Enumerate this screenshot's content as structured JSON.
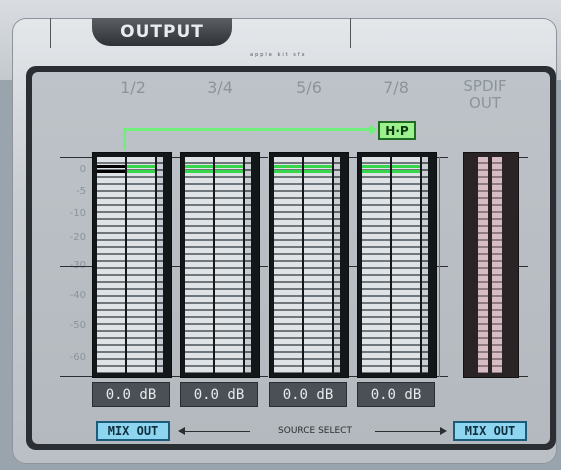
{
  "header": {
    "tab_label": "OUTPUT",
    "tiny_labels": "apple kit sfx"
  },
  "channels": [
    {
      "label": "1/2",
      "level": "0.0 dB",
      "clip": true
    },
    {
      "label": "3/4",
      "level": "0.0 dB",
      "clip": false
    },
    {
      "label": "5/6",
      "level": "0.0 dB",
      "clip": false
    },
    {
      "label": "7/8",
      "level": "0.0 dB",
      "clip": false
    }
  ],
  "spdif": {
    "label_line1": "SPDIF",
    "label_line2": "OUT"
  },
  "routing": {
    "hp_label": "H·P"
  },
  "scale": [
    "0",
    "-5",
    "-10",
    "-20",
    "-30",
    "-40",
    "-50",
    "-60"
  ],
  "source_select": {
    "left_button": "MIX OUT",
    "label": "SOURCE SELECT",
    "right_button": "MIX OUT"
  },
  "colors": {
    "meter_green": "#35d64a",
    "route_green": "#6ff07a",
    "mix_button": "#8ed5f0"
  }
}
